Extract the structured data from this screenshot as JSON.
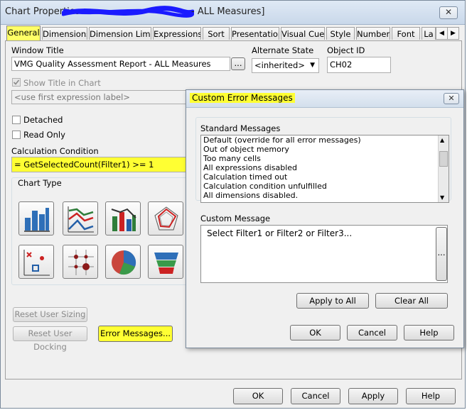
{
  "window": {
    "title_prefix": "Chart Properties",
    "title_suffix": "- ALL Measures]",
    "close_glyph": "✕"
  },
  "tabs": [
    {
      "label": "General"
    },
    {
      "label": "Dimensions"
    },
    {
      "label": "Dimension Limits"
    },
    {
      "label": "Expressions"
    },
    {
      "label": "Sort"
    },
    {
      "label": "Presentation"
    },
    {
      "label": "Visual Cues"
    },
    {
      "label": "Style"
    },
    {
      "label": "Number"
    },
    {
      "label": "Font"
    },
    {
      "label": "La"
    }
  ],
  "tab_scroll": {
    "left": "◀",
    "right": "▶"
  },
  "general": {
    "window_title_label": "Window Title",
    "window_title_value": "VMG Quality Assessment Report - ALL Measures",
    "window_title_button": "...",
    "alternate_state_label": "Alternate State",
    "alternate_state_value": "<inherited>",
    "object_id_label": "Object ID",
    "object_id_value": "CH02",
    "show_title_label": "Show Title in Chart",
    "show_title_checked": true,
    "first_expr_placeholder": "<use first expression label>",
    "detached_label": "Detached",
    "read_only_label": "Read Only",
    "calc_condition_label": "Calculation Condition",
    "calc_condition_value": "= GetSelectedCount(Filter1) >= 1",
    "chart_type_label": "Chart Type",
    "chart_types": [
      {
        "name": "bar-chart-icon"
      },
      {
        "name": "line-chart-icon"
      },
      {
        "name": "combo-chart-icon"
      },
      {
        "name": "radar-chart-icon"
      },
      {
        "name": "scatter-chart-icon"
      },
      {
        "name": "grid-chart-icon"
      },
      {
        "name": "pie-chart-icon"
      },
      {
        "name": "funnel-chart-icon"
      }
    ],
    "reset_user_sizing": "Reset User Sizing",
    "reset_user_docking": "Reset User Docking",
    "error_messages_button": "Error Messages..."
  },
  "dialog": {
    "title": "Custom Error Messages",
    "close_glyph": "✕",
    "standard_messages_label": "Standard Messages",
    "standard_messages": [
      "Default (override for all error messages)",
      "Out of object memory",
      "Too many cells",
      "All expressions disabled",
      "Calculation timed out",
      "Calculation condition unfulfilled",
      "All dimensions disabled."
    ],
    "custom_message_label": "Custom Message",
    "custom_message_value": "Select Filter1 or Filter2 or Filter3...",
    "custom_message_button": "...",
    "apply_to_all": "Apply to All",
    "clear_all": "Clear All",
    "ok": "OK",
    "cancel": "Cancel",
    "help": "Help"
  },
  "footer": {
    "ok": "OK",
    "cancel": "Cancel",
    "apply": "Apply",
    "help": "Help"
  },
  "colors": {
    "highlight": "#ffff33",
    "scribble": "#1a1aff"
  }
}
